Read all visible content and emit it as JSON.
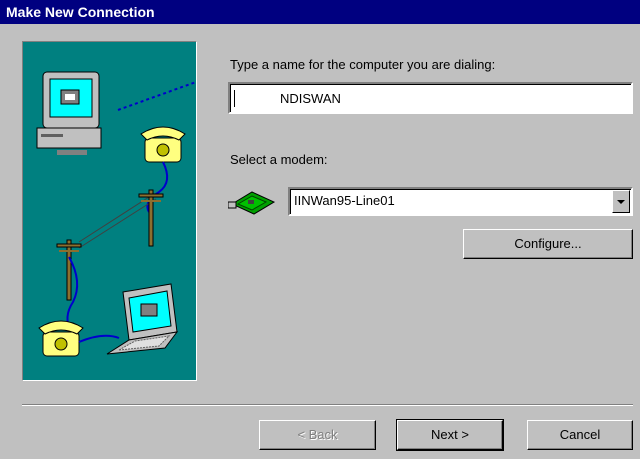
{
  "window": {
    "title": "Make New Connection"
  },
  "form": {
    "name_prompt": "Type a name for the computer you are dialing:",
    "name_value": "NDISWAN",
    "modem_prompt": "Select a modem:",
    "modem_selected": "IINWan95-Line01"
  },
  "buttons": {
    "configure": "Configure...",
    "back": "< Back",
    "next": "Next >",
    "cancel": "Cancel"
  },
  "icons": [
    "computer-icon",
    "telephone-icon",
    "utility-pole-icon",
    "laptop-icon",
    "modem-card-icon",
    "dropdown-arrow-icon"
  ]
}
